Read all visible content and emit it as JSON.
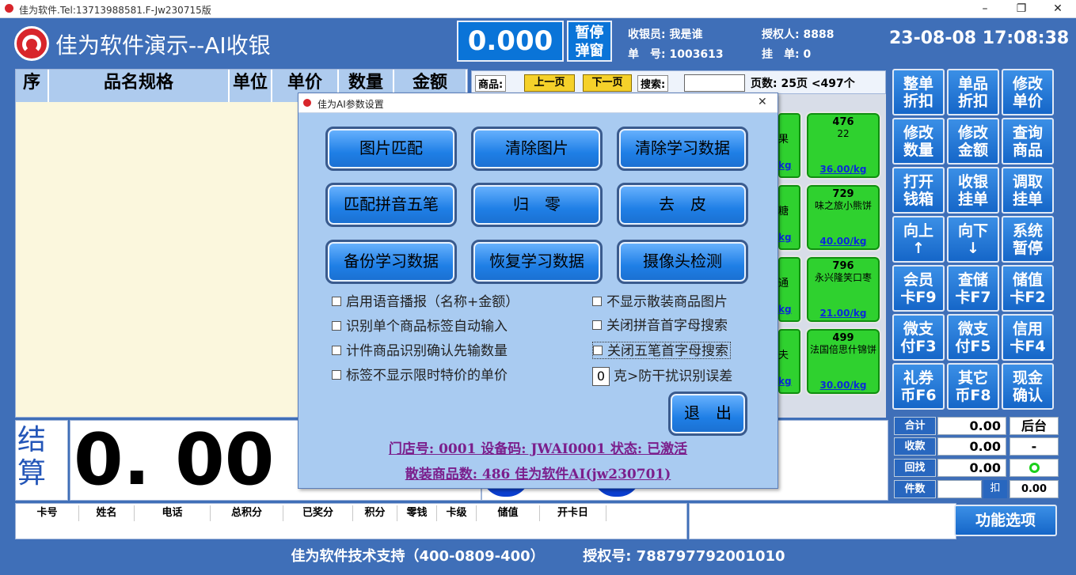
{
  "window": {
    "title": "佳为软件.Tel:13713988581.F-Jw230715版",
    "minimize": "–",
    "maximize": "❐",
    "close": "✕"
  },
  "header": {
    "app_title": "佳为软件演示--AI收银",
    "amount": "0.000",
    "pause_button": "暂停弹窗",
    "cashier": "收银员: 我是谁",
    "order_no": "单　号: 1003613",
    "authorizer": "授权人: 8888",
    "held": "挂　单: 0",
    "datetime": "23-08-08 17:08:38"
  },
  "sale_table": {
    "columns": [
      "序",
      "品名规格",
      "单位",
      "单价",
      "数量",
      "金额"
    ]
  },
  "products_bar": {
    "label": "商品:",
    "prev": "上一页",
    "next": "下一页",
    "search_label": "搜索:",
    "search_value": "",
    "page_info": "页数: 25页 <497个"
  },
  "product_tiles": [
    {
      "code": "476",
      "name": "22",
      "price": "36.00/kg"
    },
    {
      "code": "729",
      "name": "味之旅小熊饼",
      "price": "40.00/kg"
    },
    {
      "code": "796",
      "name": "永兴隆笑口枣",
      "price": "21.00/kg"
    },
    {
      "code": "499",
      "name": "法国倍思什锦饼",
      "price": "30.00/kg"
    }
  ],
  "partial_tiles": [
    {
      "name": "果",
      "price": "kg"
    },
    {
      "name": "糖",
      "price": "kg"
    },
    {
      "name": "通",
      "price": "kg"
    },
    {
      "name": "夫",
      "price": "kg"
    }
  ],
  "right_buttons": [
    "整单折扣",
    "单品折扣",
    "修改单价",
    "修改数量",
    "修改金额",
    "查询商品",
    "打开钱箱",
    "收银挂单",
    "调取挂单",
    "向上↑",
    "向下↓",
    "系统暂停",
    "会员卡F9",
    "查储卡F7",
    "储值卡F2",
    "微支付F3",
    "微支付F5",
    "信用卡F4",
    "礼券币F6",
    "其它币F8",
    "现金确认"
  ],
  "totals": {
    "total_label": "合计",
    "total_value": "0.00",
    "mode": "后台",
    "received_label": "收款",
    "received_value": "0.00",
    "received_extra": "-",
    "change_label": "回找",
    "change_value": "0.00",
    "status_icon": "ring-icon",
    "count_label": "件数",
    "count_value": "",
    "discount_label": "扣",
    "discount_value": "0.00"
  },
  "settle": {
    "label": "结算",
    "amount": "0. 00"
  },
  "member_columns": [
    "卡号",
    "姓名",
    "电话",
    "总积分",
    "已奖分",
    "积分",
    "零钱",
    "卡级",
    "储值",
    "开卡日"
  ],
  "function_button": "功能选项",
  "footer": {
    "support": "佳为软件技术支持（400-0809-400）",
    "license": "授权号: 788797792001010"
  },
  "dialog": {
    "title": "佳为AI参数设置",
    "close": "✕",
    "buttons": [
      "图片匹配",
      "清除图片",
      "清除学习数据",
      "匹配拼音五笔",
      "归　零",
      "去　皮",
      "备份学习数据",
      "恢复学习数据",
      "摄像头检测"
    ],
    "checks_left": [
      "启用语音播报（名称+金额）",
      "识别单个商品标签自动输入",
      "计件商品识别确认先输数量",
      "标签不显示限时特价的单价"
    ],
    "checks_right": [
      "不显示散装商品图片",
      "关闭拼音首字母搜索",
      "关闭五笔首字母搜索"
    ],
    "gram_value": "0",
    "gram_label": "克>防干扰识别误差",
    "exit_button": "退　出",
    "store_info": "门店号: 0001  设备码: JWAI0001  状态: 已激活",
    "bulk_info": "散装商品数: 486   佳为软件AI(jw230701)"
  }
}
